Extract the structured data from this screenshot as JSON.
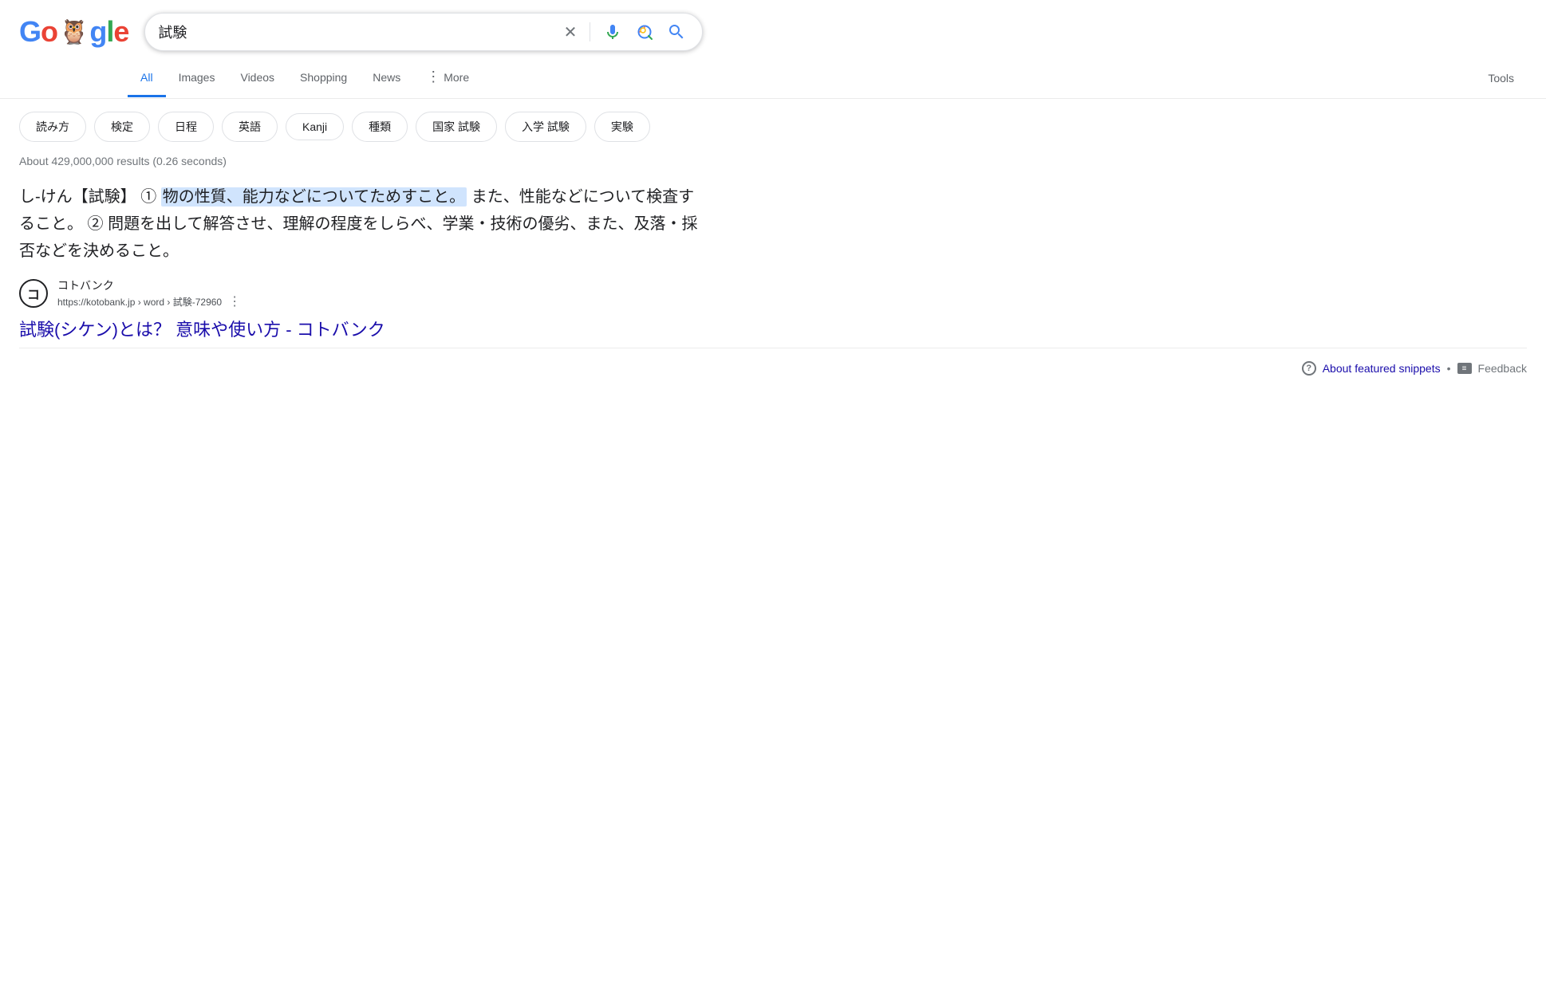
{
  "header": {
    "logo": {
      "g1": "G",
      "o1": "o",
      "o2": "o",
      "g2": "g",
      "l": "l",
      "e": "e",
      "owl": "🦉"
    },
    "search": {
      "query": "試験",
      "placeholder": "試験",
      "clear_label": "×",
      "voice_label": "voice search",
      "lens_label": "search by image",
      "search_label": "Google Search"
    }
  },
  "nav": {
    "tabs": [
      {
        "id": "all",
        "label": "All",
        "active": true
      },
      {
        "id": "images",
        "label": "Images",
        "active": false
      },
      {
        "id": "videos",
        "label": "Videos",
        "active": false
      },
      {
        "id": "shopping",
        "label": "Shopping",
        "active": false
      },
      {
        "id": "news",
        "label": "News",
        "active": false
      },
      {
        "id": "more",
        "label": "More",
        "active": false
      }
    ],
    "tools_label": "Tools"
  },
  "chips": [
    "読み方",
    "検定",
    "日程",
    "英語",
    "Kanji",
    "種類",
    "国家 試験",
    "入学 試験",
    "実験"
  ],
  "results": {
    "info": "About 429,000,000 results (0.26 seconds)",
    "featured_snippet": {
      "text_before": "し‐けん【試験】 ① ",
      "text_highlighted": "物の性質、能力などについてためすこと。",
      "text_after": " また、性能などについて検査すること。 ② 問題を出して解答させ、理解の程度をしらべ、学業・技術の優劣、また、及落・採否などを決めること。"
    },
    "source": {
      "icon_label": "コ",
      "name": "コトバンク",
      "url": "https://kotobank.jp › word › 試験-72960",
      "more_label": "⋮"
    },
    "title": "試験(シケン)とは？ 意味や使い方 - コトバンク",
    "title_url": "#"
  },
  "footer": {
    "about_snippets": "About featured snippets",
    "dot": "•",
    "feedback": "Feedback"
  }
}
